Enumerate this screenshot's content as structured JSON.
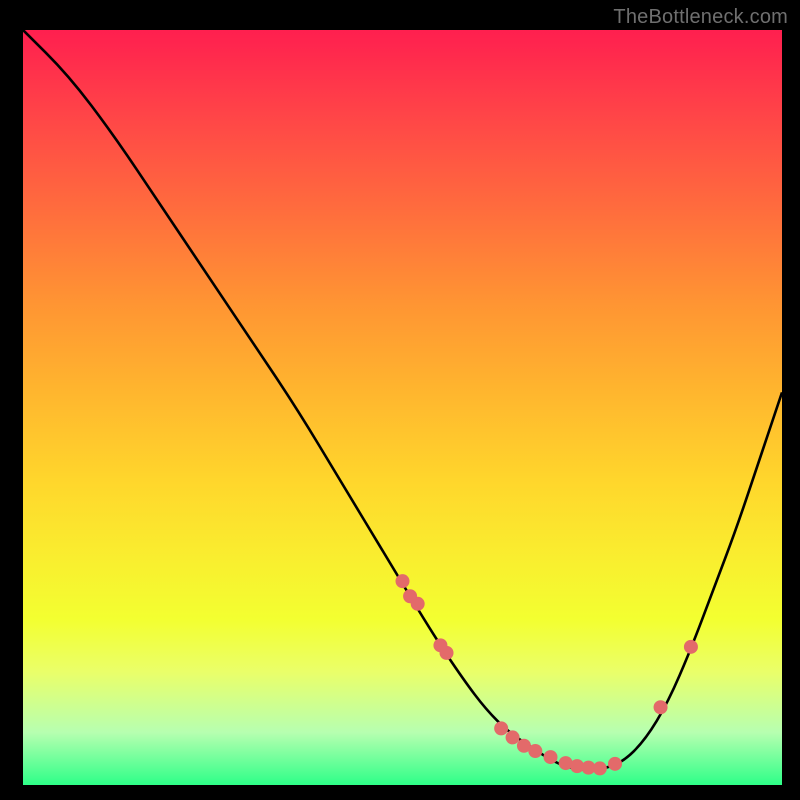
{
  "watermark": "TheBottleneck.com",
  "chart_data": {
    "type": "line",
    "title": "",
    "xlabel": "",
    "ylabel": "",
    "xlim": [
      0,
      100
    ],
    "ylim": [
      0,
      100
    ],
    "grid": false,
    "curve": {
      "name": "bottleneck-curve",
      "color": "#000000",
      "x": [
        0,
        6,
        12,
        18,
        24,
        30,
        36,
        42,
        48,
        54,
        58,
        61,
        64,
        67,
        70,
        73,
        76,
        79,
        82,
        85,
        88,
        91,
        94,
        97,
        100
      ],
      "y": [
        100,
        94,
        86,
        77,
        68,
        59,
        50,
        40,
        30,
        20,
        14,
        10,
        7,
        5,
        3,
        2,
        2,
        3,
        6,
        11,
        18,
        26,
        34,
        43,
        52
      ]
    },
    "points": {
      "name": "data-points",
      "color": "#e36a6a",
      "radius": 7,
      "x": [
        50,
        51,
        52,
        55,
        55.8,
        63,
        64.5,
        66,
        67.5,
        69.5,
        71.5,
        73,
        74.5,
        76,
        78,
        84,
        88
      ],
      "y": [
        27,
        25,
        24,
        18.5,
        17.5,
        7.5,
        6.3,
        5.2,
        4.5,
        3.7,
        2.9,
        2.5,
        2.3,
        2.2,
        2.8,
        10.3,
        18.3
      ]
    }
  },
  "colors": {
    "background": "#000000",
    "gradient_top": "#ff1f4f",
    "gradient_bottom": "#2eff88"
  }
}
